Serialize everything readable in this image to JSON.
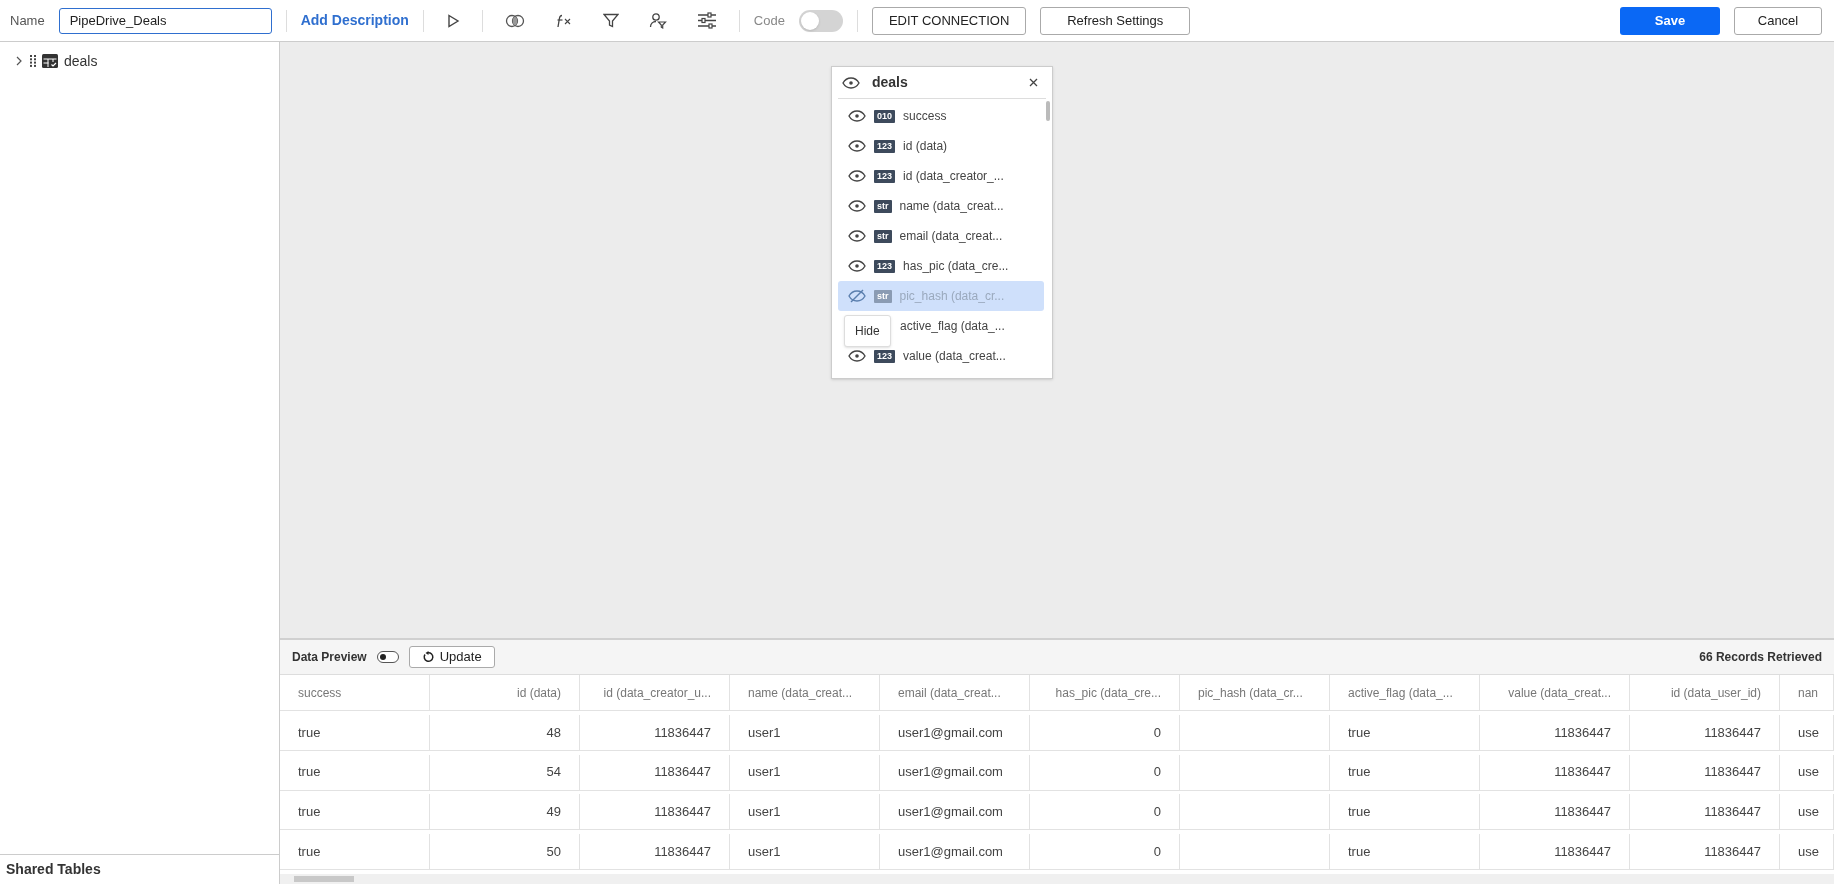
{
  "toolbar": {
    "name_label": "Name",
    "name_value": "PipeDrive_Deals",
    "add_description": "Add Description",
    "code_label": "Code",
    "code_toggle": {
      "on": false
    },
    "edit_connection": "EDIT CONNECTION",
    "refresh_settings": "Refresh Settings",
    "save": "Save",
    "cancel": "Cancel"
  },
  "sidebar": {
    "items": [
      {
        "label": "deals",
        "expanded": false
      }
    ],
    "footer": "Shared Tables"
  },
  "fields_panel": {
    "title": "deals",
    "tooltip": "Hide",
    "fields": [
      {
        "type": "010",
        "label": "success",
        "selected": false
      },
      {
        "type": "123",
        "label": "id (data)",
        "selected": false
      },
      {
        "type": "123",
        "label": "id (data_creator_...",
        "selected": false
      },
      {
        "type": "str",
        "label": "name (data_creat...",
        "selected": false
      },
      {
        "type": "str",
        "label": "email (data_creat...",
        "selected": false
      },
      {
        "type": "123",
        "label": "has_pic (data_cre...",
        "selected": false
      },
      {
        "type": "str",
        "label": "pic_hash (data_cr...",
        "selected": true
      },
      {
        "label": "active_flag (data_...",
        "selected": false
      },
      {
        "type": "123",
        "label": "value (data_creat...",
        "selected": false
      }
    ]
  },
  "data_preview": {
    "title": "Data Preview",
    "toggle": {
      "on": false
    },
    "update": "Update",
    "records": "66 Records Retrieved",
    "columns": [
      {
        "label": "success",
        "kind": "text"
      },
      {
        "label": "id (data)",
        "kind": "number"
      },
      {
        "label": "id (data_creator_u...",
        "kind": "number"
      },
      {
        "label": "name (data_creat...",
        "kind": "text"
      },
      {
        "label": "email (data_creat...",
        "kind": "text"
      },
      {
        "label": "has_pic (data_cre...",
        "kind": "number"
      },
      {
        "label": "pic_hash (data_cr...",
        "kind": "text"
      },
      {
        "label": "active_flag (data_...",
        "kind": "text"
      },
      {
        "label": "value (data_creat...",
        "kind": "number"
      },
      {
        "label": "id (data_user_id)",
        "kind": "number"
      },
      {
        "label": "nan",
        "kind": "text"
      }
    ],
    "rows": [
      [
        "true",
        "48",
        "11836447",
        "user1",
        "user1@gmail.com",
        "0",
        "",
        "true",
        "11836447",
        "11836447",
        "use"
      ],
      [
        "true",
        "54",
        "11836447",
        "user1",
        "user1@gmail.com",
        "0",
        "",
        "true",
        "11836447",
        "11836447",
        "use"
      ],
      [
        "true",
        "49",
        "11836447",
        "user1",
        "user1@gmail.com",
        "0",
        "",
        "true",
        "11836447",
        "11836447",
        "use"
      ],
      [
        "true",
        "50",
        "11836447",
        "user1",
        "user1@gmail.com",
        "0",
        "",
        "true",
        "11836447",
        "11836447",
        "use"
      ]
    ]
  }
}
